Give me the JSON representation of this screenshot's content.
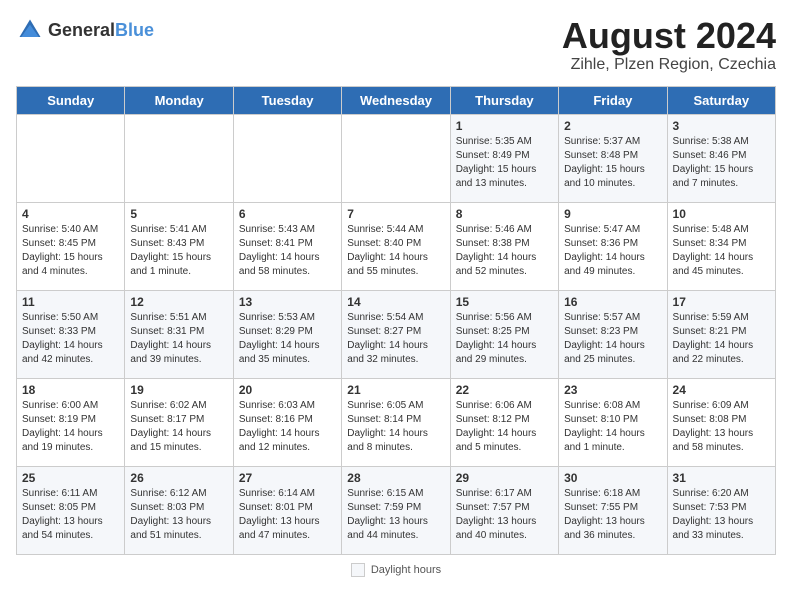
{
  "header": {
    "logo": {
      "general": "General",
      "blue": "Blue"
    },
    "month_year": "August 2024",
    "location": "Zihle, Plzen Region, Czechia"
  },
  "days_of_week": [
    "Sunday",
    "Monday",
    "Tuesday",
    "Wednesday",
    "Thursday",
    "Friday",
    "Saturday"
  ],
  "weeks": [
    [
      {
        "day": "",
        "info": ""
      },
      {
        "day": "",
        "info": ""
      },
      {
        "day": "",
        "info": ""
      },
      {
        "day": "",
        "info": ""
      },
      {
        "day": "1",
        "info": "Sunrise: 5:35 AM\nSunset: 8:49 PM\nDaylight: 15 hours\nand 13 minutes."
      },
      {
        "day": "2",
        "info": "Sunrise: 5:37 AM\nSunset: 8:48 PM\nDaylight: 15 hours\nand 10 minutes."
      },
      {
        "day": "3",
        "info": "Sunrise: 5:38 AM\nSunset: 8:46 PM\nDaylight: 15 hours\nand 7 minutes."
      }
    ],
    [
      {
        "day": "4",
        "info": "Sunrise: 5:40 AM\nSunset: 8:45 PM\nDaylight: 15 hours\nand 4 minutes."
      },
      {
        "day": "5",
        "info": "Sunrise: 5:41 AM\nSunset: 8:43 PM\nDaylight: 15 hours\nand 1 minute."
      },
      {
        "day": "6",
        "info": "Sunrise: 5:43 AM\nSunset: 8:41 PM\nDaylight: 14 hours\nand 58 minutes."
      },
      {
        "day": "7",
        "info": "Sunrise: 5:44 AM\nSunset: 8:40 PM\nDaylight: 14 hours\nand 55 minutes."
      },
      {
        "day": "8",
        "info": "Sunrise: 5:46 AM\nSunset: 8:38 PM\nDaylight: 14 hours\nand 52 minutes."
      },
      {
        "day": "9",
        "info": "Sunrise: 5:47 AM\nSunset: 8:36 PM\nDaylight: 14 hours\nand 49 minutes."
      },
      {
        "day": "10",
        "info": "Sunrise: 5:48 AM\nSunset: 8:34 PM\nDaylight: 14 hours\nand 45 minutes."
      }
    ],
    [
      {
        "day": "11",
        "info": "Sunrise: 5:50 AM\nSunset: 8:33 PM\nDaylight: 14 hours\nand 42 minutes."
      },
      {
        "day": "12",
        "info": "Sunrise: 5:51 AM\nSunset: 8:31 PM\nDaylight: 14 hours\nand 39 minutes."
      },
      {
        "day": "13",
        "info": "Sunrise: 5:53 AM\nSunset: 8:29 PM\nDaylight: 14 hours\nand 35 minutes."
      },
      {
        "day": "14",
        "info": "Sunrise: 5:54 AM\nSunset: 8:27 PM\nDaylight: 14 hours\nand 32 minutes."
      },
      {
        "day": "15",
        "info": "Sunrise: 5:56 AM\nSunset: 8:25 PM\nDaylight: 14 hours\nand 29 minutes."
      },
      {
        "day": "16",
        "info": "Sunrise: 5:57 AM\nSunset: 8:23 PM\nDaylight: 14 hours\nand 25 minutes."
      },
      {
        "day": "17",
        "info": "Sunrise: 5:59 AM\nSunset: 8:21 PM\nDaylight: 14 hours\nand 22 minutes."
      }
    ],
    [
      {
        "day": "18",
        "info": "Sunrise: 6:00 AM\nSunset: 8:19 PM\nDaylight: 14 hours\nand 19 minutes."
      },
      {
        "day": "19",
        "info": "Sunrise: 6:02 AM\nSunset: 8:17 PM\nDaylight: 14 hours\nand 15 minutes."
      },
      {
        "day": "20",
        "info": "Sunrise: 6:03 AM\nSunset: 8:16 PM\nDaylight: 14 hours\nand 12 minutes."
      },
      {
        "day": "21",
        "info": "Sunrise: 6:05 AM\nSunset: 8:14 PM\nDaylight: 14 hours\nand 8 minutes."
      },
      {
        "day": "22",
        "info": "Sunrise: 6:06 AM\nSunset: 8:12 PM\nDaylight: 14 hours\nand 5 minutes."
      },
      {
        "day": "23",
        "info": "Sunrise: 6:08 AM\nSunset: 8:10 PM\nDaylight: 14 hours\nand 1 minute."
      },
      {
        "day": "24",
        "info": "Sunrise: 6:09 AM\nSunset: 8:08 PM\nDaylight: 13 hours\nand 58 minutes."
      }
    ],
    [
      {
        "day": "25",
        "info": "Sunrise: 6:11 AM\nSunset: 8:05 PM\nDaylight: 13 hours\nand 54 minutes."
      },
      {
        "day": "26",
        "info": "Sunrise: 6:12 AM\nSunset: 8:03 PM\nDaylight: 13 hours\nand 51 minutes."
      },
      {
        "day": "27",
        "info": "Sunrise: 6:14 AM\nSunset: 8:01 PM\nDaylight: 13 hours\nand 47 minutes."
      },
      {
        "day": "28",
        "info": "Sunrise: 6:15 AM\nSunset: 7:59 PM\nDaylight: 13 hours\nand 44 minutes."
      },
      {
        "day": "29",
        "info": "Sunrise: 6:17 AM\nSunset: 7:57 PM\nDaylight: 13 hours\nand 40 minutes."
      },
      {
        "day": "30",
        "info": "Sunrise: 6:18 AM\nSunset: 7:55 PM\nDaylight: 13 hours\nand 36 minutes."
      },
      {
        "day": "31",
        "info": "Sunrise: 6:20 AM\nSunset: 7:53 PM\nDaylight: 13 hours\nand 33 minutes."
      }
    ]
  ],
  "footer": {
    "daylight_label": "Daylight hours"
  }
}
